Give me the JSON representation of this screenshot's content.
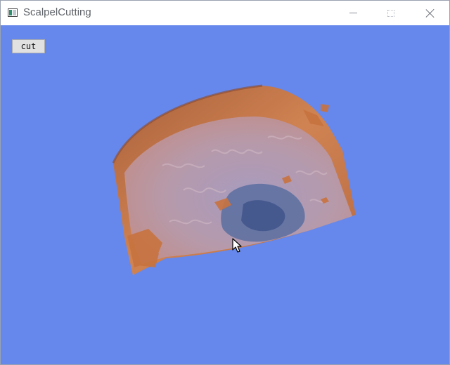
{
  "window": {
    "title": "ScalpelCutting",
    "controls": [
      "minimize",
      "maximize",
      "close"
    ]
  },
  "toolbar": {
    "cut_label": "cut"
  },
  "viewport": {
    "background_color": "#6688ec",
    "content": "3D volume-rendered head model"
  },
  "colors": {
    "skin": "#c9774a",
    "tissue": "#b59bb0",
    "dark_tissue": "#4a5f93"
  },
  "icons": [
    "app-icon",
    "minimize-icon",
    "maximize-icon",
    "close-icon",
    "mouse-pointer-icon"
  ]
}
